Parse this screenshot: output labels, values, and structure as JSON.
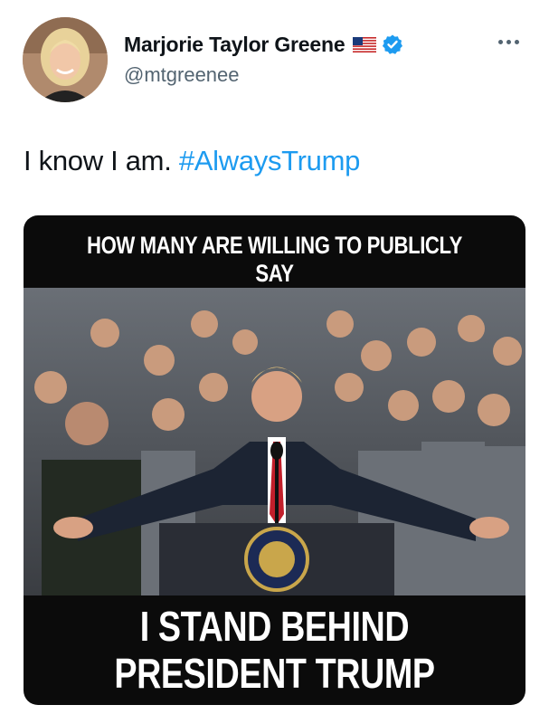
{
  "author": {
    "display_name": "Marjorie Taylor Greene",
    "handle": "@mtgreenee",
    "avatar_icon": "profile-photo",
    "flag_icon": "us-flag-icon",
    "verified_icon": "verified-badge-icon",
    "verified_color": "#1d9bf0"
  },
  "more_icon": "more-options-icon",
  "tweet": {
    "text": "I know I am. ",
    "hashtag": "#AlwaysTrump",
    "hashtag_color": "#1d9bf0"
  },
  "media": {
    "top_caption": "HOW MANY ARE WILLING TO PUBLICLY SAY",
    "bottom_caption_line1": "I STAND BEHIND",
    "bottom_caption_line2": "PRESIDENT TRUMP"
  }
}
